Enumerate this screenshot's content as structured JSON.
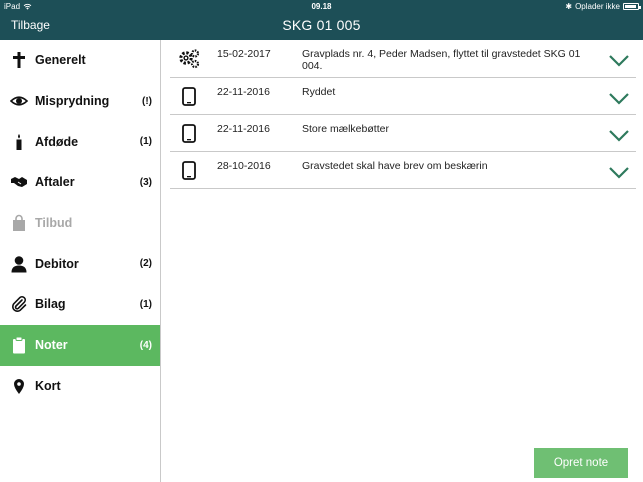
{
  "status_bar": {
    "device": "iPad",
    "time": "09.18",
    "charging_text": "Oplader ikke"
  },
  "nav": {
    "back_label": "Tilbage",
    "title": "SKG 01  005"
  },
  "sidebar": {
    "items": [
      {
        "label": "Generelt",
        "count": "",
        "icon": "cross-icon"
      },
      {
        "label": "Misprydning",
        "count": "(!)",
        "icon": "eye-icon"
      },
      {
        "label": "Afdøde",
        "count": "(1)",
        "icon": "candle-icon"
      },
      {
        "label": "Aftaler",
        "count": "(3)",
        "icon": "handshake-icon"
      },
      {
        "label": "Tilbud",
        "count": "",
        "icon": "shopping-bag-icon"
      },
      {
        "label": "Debitor",
        "count": "(2)",
        "icon": "person-icon"
      },
      {
        "label": "Bilag",
        "count": "(1)",
        "icon": "paperclip-icon"
      },
      {
        "label": "Noter",
        "count": "(4)",
        "icon": "clipboard-icon"
      },
      {
        "label": "Kort",
        "count": "",
        "icon": "map-pin-icon"
      }
    ],
    "active_item": "Noter",
    "disabled_item": "Tilbud"
  },
  "notes": [
    {
      "date": "15-02-2017",
      "text": "Gravplads nr. 4, Peder Madsen, flyttet til gravstedet SKG 01 004.",
      "icon": "gears-icon"
    },
    {
      "date": "22-11-2016",
      "text": "Ryddet",
      "icon": "tablet-icon"
    },
    {
      "date": "22-11-2016",
      "text": "Store mælkebøtter",
      "icon": "tablet-icon"
    },
    {
      "date": "28-10-2016",
      "text": "Gravstedet skal have brev om beskærin",
      "icon": "tablet-icon"
    }
  ],
  "actions": {
    "create_note_label": "Opret note"
  },
  "colors": {
    "header": "#1d4f57",
    "active": "#5cb860",
    "button": "#6fbf73",
    "chevron": "#2e7a5d",
    "disabled": "#a8a8a8"
  }
}
